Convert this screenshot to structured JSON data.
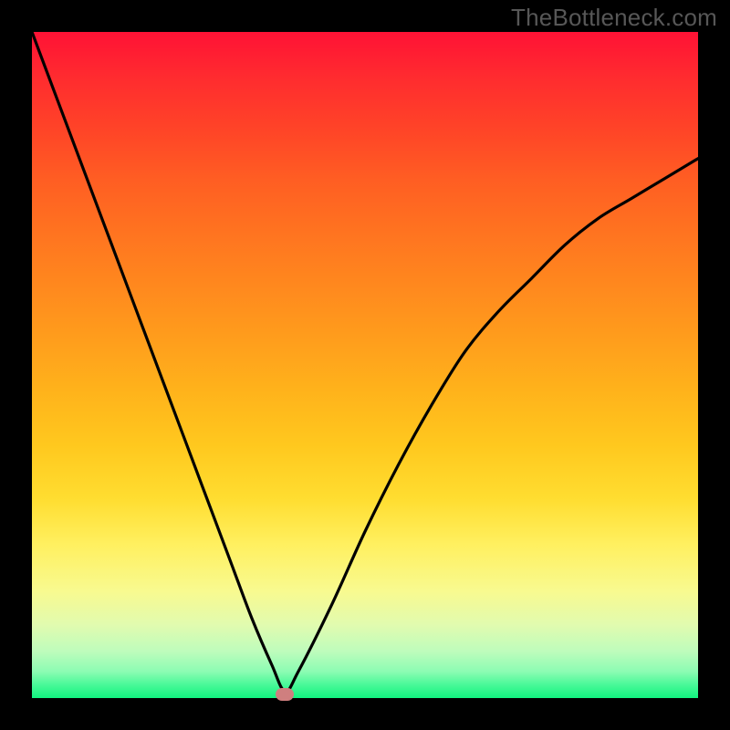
{
  "attribution": "TheBottleneck.com",
  "chart_data": {
    "type": "line",
    "title": "",
    "xlabel": "",
    "ylabel": "",
    "xlim": [
      0,
      100
    ],
    "ylim": [
      0,
      100
    ],
    "background_gradient": {
      "orientation": "vertical",
      "stops": [
        {
          "pct": 0,
          "color": "#ff1235",
          "meaning": "high-bottleneck"
        },
        {
          "pct": 50,
          "color": "#ffaa1c",
          "meaning": "moderate"
        },
        {
          "pct": 80,
          "color": "#fff060",
          "meaning": "low"
        },
        {
          "pct": 100,
          "color": "#11f37f",
          "meaning": "optimal"
        }
      ]
    },
    "series": [
      {
        "name": "bottleneck-curve",
        "color": "#000000",
        "x": [
          0,
          3,
          6,
          9,
          12,
          15,
          18,
          21,
          24,
          27,
          30,
          33,
          36,
          38,
          40,
          45,
          50,
          55,
          60,
          65,
          70,
          75,
          80,
          85,
          90,
          95,
          100
        ],
        "y": [
          100,
          92,
          84,
          76,
          68,
          60,
          52,
          44,
          36,
          28,
          20,
          12,
          5,
          1,
          4,
          14,
          25,
          35,
          44,
          52,
          58,
          63,
          68,
          72,
          75,
          78,
          81
        ]
      }
    ],
    "minimum_marker": {
      "x": 38,
      "y": 0.6,
      "color": "#cf7f7f"
    },
    "annotations": []
  }
}
